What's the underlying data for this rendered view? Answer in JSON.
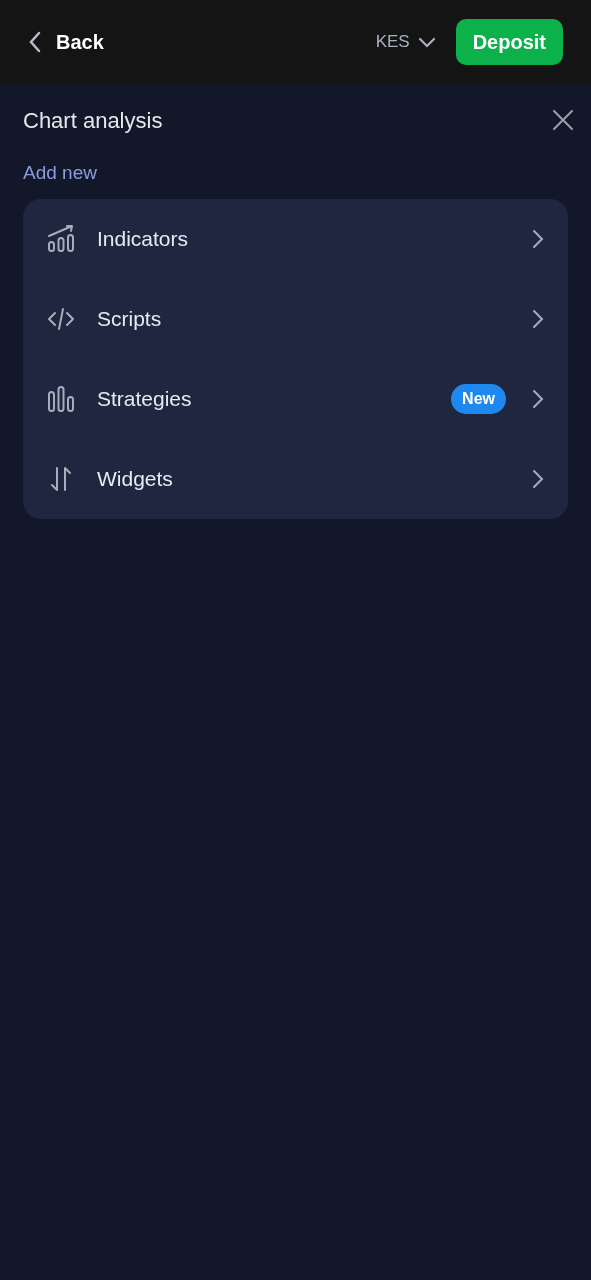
{
  "header": {
    "back": "Back",
    "currency": "KES",
    "deposit": "Deposit"
  },
  "panel": {
    "title": "Chart analysis",
    "section": "Add new",
    "items": [
      {
        "kind": "indicators",
        "label": "Indicators"
      },
      {
        "kind": "scripts",
        "label": "Scripts"
      },
      {
        "kind": "strategies",
        "label": "Strategies",
        "badge": "New"
      },
      {
        "kind": "widgets",
        "label": "Widgets"
      }
    ]
  }
}
